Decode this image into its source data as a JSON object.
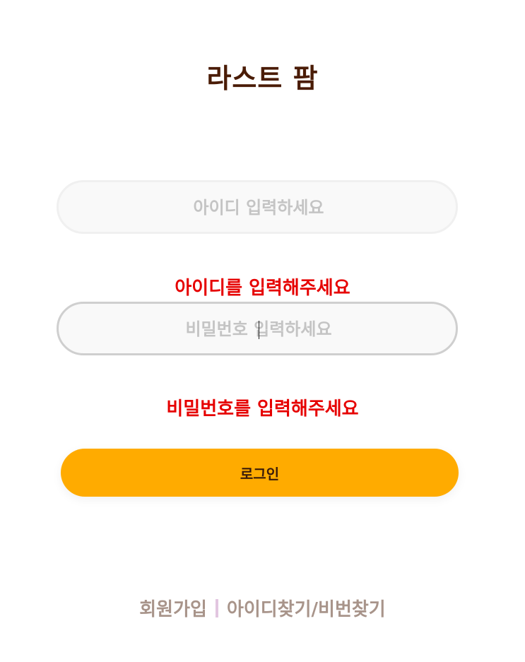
{
  "app": {
    "title": "라스트 팜"
  },
  "login_form": {
    "id_field": {
      "placeholder": "아이디 입력하세요",
      "value": "",
      "error": "아이디를 입력해주세요"
    },
    "password_field": {
      "placeholder": "비밀번호 입력하세요",
      "value": "",
      "error": "비밀번호를 입력해주세요"
    },
    "login_button_label": "로그인"
  },
  "footer": {
    "signup_label": "회원가입",
    "find_account_label": "아이디찾기/비번찾기"
  },
  "colors": {
    "accent": "#ffab00",
    "title": "#4a1c06",
    "error": "#e60000",
    "footer_text": "#a8948a",
    "divider": "#e2c6e0"
  }
}
